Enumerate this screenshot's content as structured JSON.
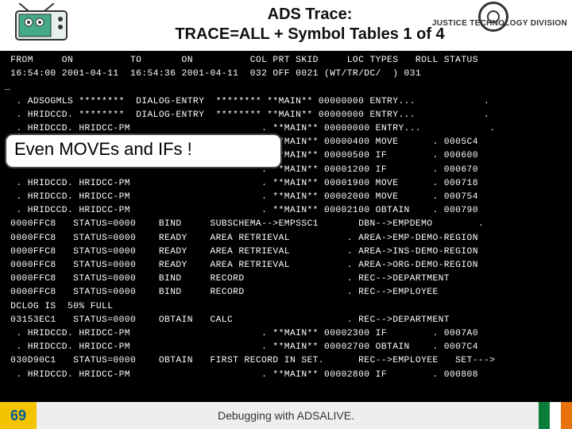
{
  "header": {
    "title_line1": "ADS Trace:",
    "title_line2": "TRACE=ALL + Symbol Tables 1 of  4",
    "division": "JUSTICE TECHNOLOGY DIVISION"
  },
  "callout": {
    "text": "Even MOVEs and IFs !"
  },
  "footer": {
    "slide_number": "69",
    "caption": "Debugging with ADSALIVE."
  },
  "terminal": {
    "lines": [
      " FROM     ON          TO       ON          COL PRT SKID     LOC TYPES   ROLL STATUS",
      " 16:54:00 2001-04-11  16:54:36 2001-04-11  032 OFF 0021 (WT/TR/DC/  ) 031",
      "_",
      "  . ADSOGMLS ********  DIALOG-ENTRY  ******** **MAIN** 00000000 ENTRY...            .",
      "  . HRIDCCD. ********  DIALOG-ENTRY  ******** **MAIN** 00000000 ENTRY...            .",
      "  . HRIDCCD. HRIDCC-PM                       . **MAIN** 00000000 ENTRY...            .",
      "  . HRIDCCD. HRIDCC-PM                       . **MAIN** 00000400 MOVE      . 0005C4",
      "                                             . **MAIN** 00000500 IF        . 000600",
      "                                             . **MAIN** 00001200 IF        . 000670",
      "  . HRIDCCD. HRIDCC-PM                       . **MAIN** 00001900 MOVE      . 000718",
      "  . HRIDCCD. HRIDCC-PM                       . **MAIN** 00002000 MOVE      . 000754",
      "  . HRIDCCD. HRIDCC-PM                       . **MAIN** 00002100 OBTAIN    . 000790",
      " 0000FFC8   STATUS=0000    BIND     SUBSCHEMA-->EMPSSC1       DBN-->EMPDEMO        .",
      " 0000FFC8   STATUS=0000    READY    AREA RETRIEVAL          . AREA->EMP-DEMO-REGION",
      " 0000FFC8   STATUS=0000    READY    AREA RETRIEVAL          . AREA->INS-DEMO-REGION",
      " 0000FFC8   STATUS=0000    READY    AREA RETRIEVAL          . AREA->ORG-DEMO-REGION",
      " 0000FFC8   STATUS=0000    BIND     RECORD                  . REC-->DEPARTMENT",
      " 0000FFC8   STATUS=0000    BIND     RECORD                  . REC-->EMPLOYEE",
      " DCLOG IS  50% FULL",
      " 03153EC1   STATUS=0000    OBTAIN   CALC                    . REC-->DEPARTMENT",
      "  . HRIDCCD. HRIDCC-PM                       . **MAIN** 00002300 IF        . 0007A0",
      "  . HRIDCCD. HRIDCC-PM                       . **MAIN** 00002700 OBTAIN    . 0007C4",
      " 030D90C1   STATUS=0000    OBTAIN   FIRST RECORD IN SET.      REC-->EMPLOYEE   SET--->",
      "  . HRIDCCD. HRIDCC-PM                       . **MAIN** 00002800 IF        . 000808"
    ]
  }
}
